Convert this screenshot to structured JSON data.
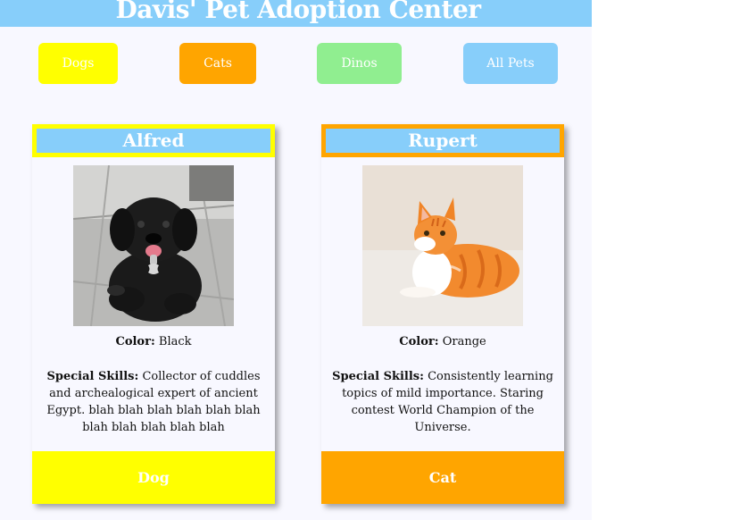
{
  "header": {
    "title": "Davis' Pet Adoption Center"
  },
  "filters": {
    "dogs": "Dogs",
    "cats": "Cats",
    "dinos": "Dinos",
    "all": "All Pets"
  },
  "colors": {
    "header": "#87cefa",
    "dogs": "#ffff00",
    "cats": "#ffa500",
    "dinos": "#90ee90",
    "all": "#87cefa",
    "page_bg": "#f8f8ff"
  },
  "pets": [
    {
      "name": "Alfred",
      "photo_icon": "black-puppy-photo",
      "color_label": "Color:",
      "color": "Black",
      "skills_label": "Special Skills:",
      "skills": "Collector of cuddles and archealogical expert of ancient Egypt. blah blah blah blah blah blah blah blah blah blah blah",
      "type": "Dog"
    },
    {
      "name": "Rupert",
      "photo_icon": "orange-cat-photo",
      "color_label": "Color:",
      "color": "Orange",
      "skills_label": "Special Skills:",
      "skills": "Consistently learning topics of mild importance. Staring contest World Champion of the Universe.",
      "type": "Cat"
    }
  ]
}
